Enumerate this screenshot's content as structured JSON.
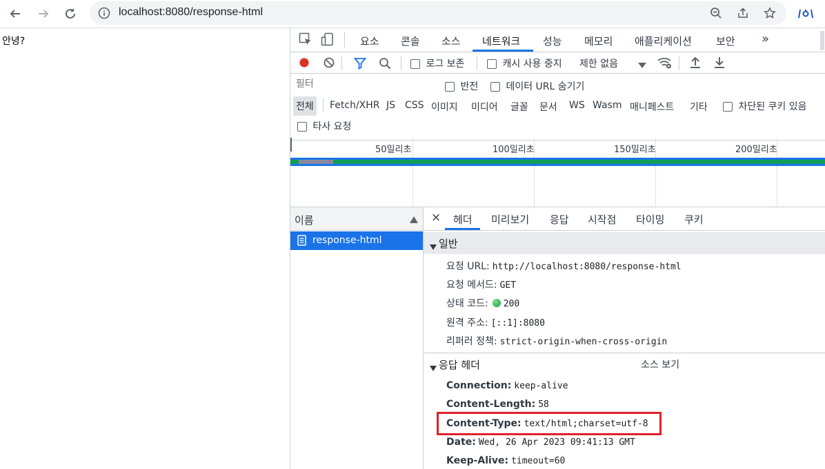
{
  "browser": {
    "url": "localhost:8080/response-html",
    "icons": {
      "back": "arrow-left",
      "forward": "arrow-right",
      "reload": "reload",
      "info": "info",
      "zoom": "zoom",
      "share": "share",
      "bookmark": "star",
      "extension": "extension"
    }
  },
  "page": {
    "text": "안녕?"
  },
  "devtools": {
    "tabs": [
      "요소",
      "콘솔",
      "소스",
      "네트워크",
      "성능",
      "메모리",
      "애플리케이션",
      "보안"
    ],
    "more_tabs": "»",
    "network_bar": {
      "preserve_log": "로그 보존",
      "disable_cache": "캐시 사용 중지",
      "throttle": "제한 없음"
    },
    "filter": {
      "placeholder": "필터",
      "invert": "반전",
      "hide_data_urls": "데이터 URL 숨기기",
      "types": [
        "전체",
        "Fetch/XHR",
        "JS",
        "CSS",
        "이미지",
        "미디어",
        "글꼴",
        "문서",
        "WS",
        "Wasm",
        "매니페스트",
        "기타"
      ],
      "blocked_cookies": "차단된 쿠키 있음",
      "third_party": "타사 요청"
    },
    "timeline": {
      "ticks": [
        "50밀리초",
        "100밀리초",
        "150밀리초",
        "200밀리초"
      ]
    },
    "names": {
      "header": "이름",
      "rows": [
        "response-html"
      ]
    },
    "details": {
      "close": "×",
      "tabs": [
        "헤더",
        "미리보기",
        "응답",
        "시작점",
        "타이밍",
        "쿠키"
      ],
      "general": {
        "title": "일반",
        "items": [
          {
            "k": "요청 URL:",
            "v": "http://localhost:8080/response-html"
          },
          {
            "k": "요청 메서드:",
            "v": "GET"
          },
          {
            "k": "상태 코드:",
            "v": "200"
          },
          {
            "k": "원격 주소:",
            "v": "[::1]:8080"
          },
          {
            "k": "리퍼러 정책:",
            "v": "strict-origin-when-cross-origin"
          }
        ]
      },
      "response_headers": {
        "title": "응답 헤더",
        "view_source": "소스 보기",
        "items": [
          {
            "k": "Connection:",
            "v": "keep-alive"
          },
          {
            "k": "Content-Length:",
            "v": "58"
          },
          {
            "k": "Content-Type:",
            "v": "text/html;charset=utf-8"
          },
          {
            "k": "Date:",
            "v": "Wed, 26 Apr 2023 09:41:13 GMT"
          },
          {
            "k": "Keep-Alive:",
            "v": "timeout=60"
          }
        ]
      }
    }
  },
  "colors": {
    "accent": "#1a73e8",
    "record": "#d93025",
    "highlight": "#e0202a",
    "status_ok": "#0f9d58",
    "timeline_bar": "#0f9d58"
  }
}
